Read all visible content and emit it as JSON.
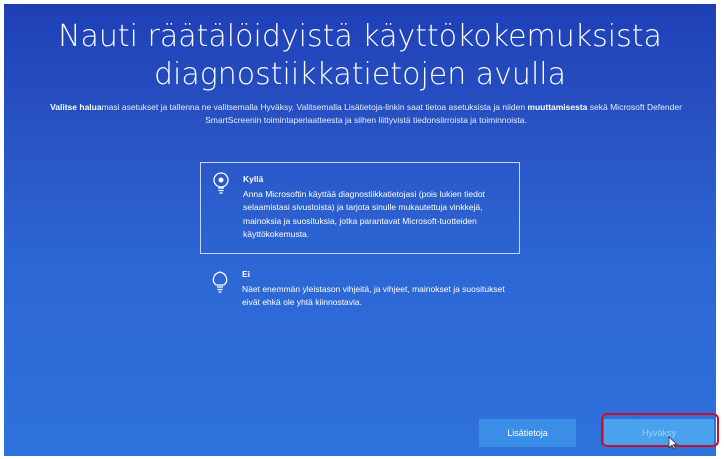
{
  "header": {
    "title_line1": "Nauti räätälöidyistä käyttökokemuksista",
    "title_line2": "diagnostiikkatietojen avulla",
    "subtitle_parts": [
      "Valitse halua",
      "masi asetukset ja tallenna ne valitsemalla Hyväksy. Valitsemalla Lisätietoja-linkin saat tietoa asetuksista ja niiden ",
      "muuttamisesta",
      " sekä Microsoft Defender SmartScreenin toimintaperiaatteesta ja siihen liittyvistä tiedonsiirroista ja toiminnoista."
    ]
  },
  "options": [
    {
      "title": "Kyllä",
      "description": "Anna Microsoftin käyttää diagnostiikkatietojasi (pois lukien tiedot selaamistasi sivustoista) ja tarjota sinulle mukautettuja vinkkejä, mainoksia ja suosituksia, jotka parantavat Microsoft-tuotteiden käyttökokemusta.",
      "icon": "lightbulb-on-icon",
      "selected": true
    },
    {
      "title": "Ei",
      "description": "Näet enemmän yleistason vihjeitä, ja vihjeet, mainokset ja suositukset eivät ehkä ole yhtä kiinnostavia.",
      "icon": "lightbulb-off-icon",
      "selected": false
    }
  ],
  "buttons": {
    "more_info": "Lisätietoja",
    "accept": "Hyväksy"
  },
  "colors": {
    "background_top": "#1f3fb6",
    "background_bottom": "#2f72dc",
    "button": "#3a8ee6",
    "highlight": "#c8102e"
  }
}
